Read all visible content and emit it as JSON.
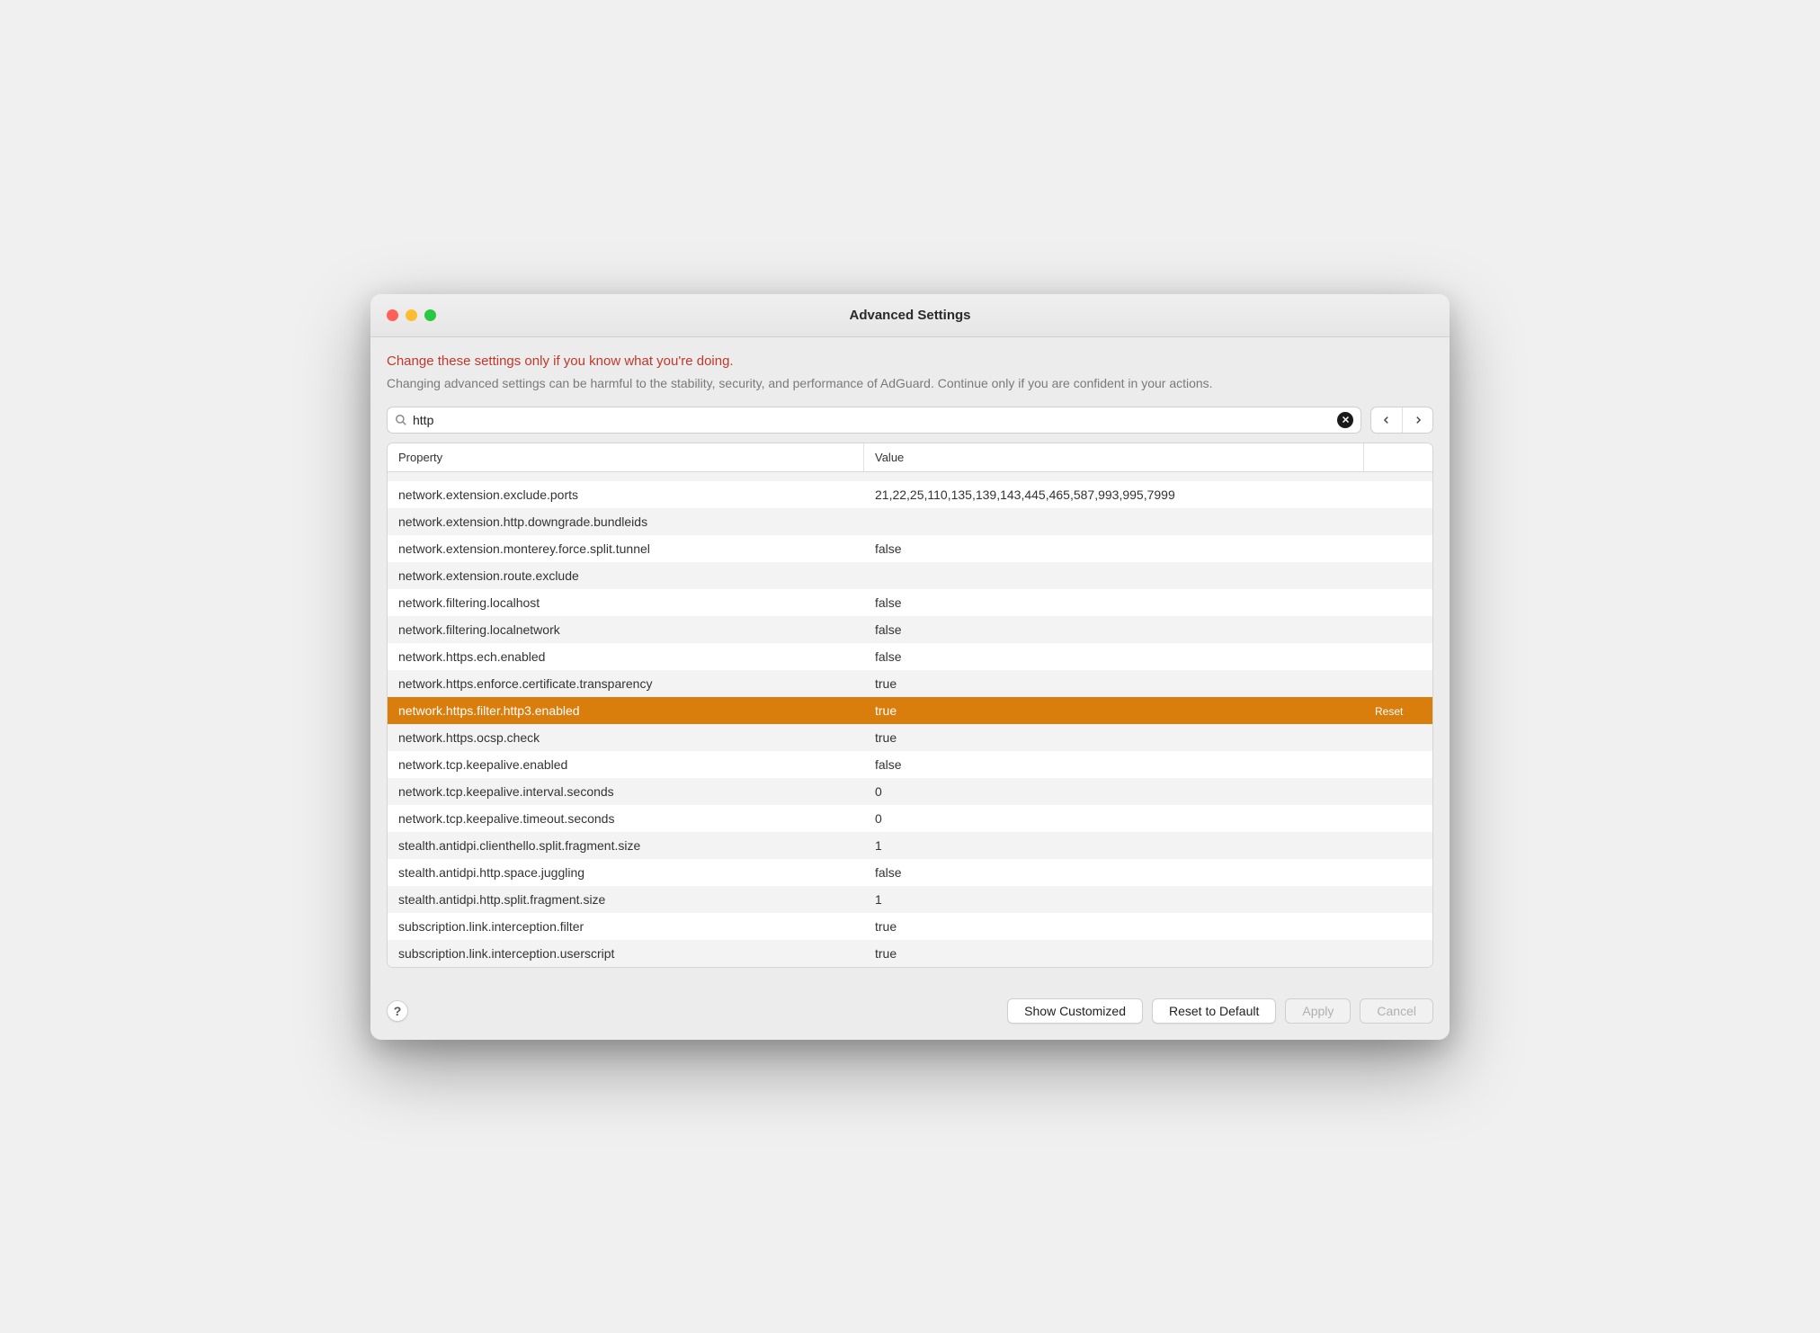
{
  "window": {
    "title": "Advanced Settings"
  },
  "warning": {
    "title": "Change these settings only if you know what you're doing.",
    "subtitle": "Changing advanced settings can be harmful to the stability, security, and performance of AdGuard. Continue only if you are confident in your actions."
  },
  "search": {
    "value": "http"
  },
  "table": {
    "headers": {
      "property": "Property",
      "value": "Value"
    },
    "rows": [
      {
        "property": "network.extension.exclude.ports",
        "value": "21,22,25,110,135,139,143,445,465,587,993,995,7999",
        "selected": false,
        "reset": ""
      },
      {
        "property": "network.extension.http.downgrade.bundleids",
        "value": "",
        "selected": false,
        "reset": ""
      },
      {
        "property": "network.extension.monterey.force.split.tunnel",
        "value": "false",
        "selected": false,
        "reset": ""
      },
      {
        "property": "network.extension.route.exclude",
        "value": "",
        "selected": false,
        "reset": ""
      },
      {
        "property": "network.filtering.localhost",
        "value": "false",
        "selected": false,
        "reset": ""
      },
      {
        "property": "network.filtering.localnetwork",
        "value": "false",
        "selected": false,
        "reset": ""
      },
      {
        "property": "network.https.ech.enabled",
        "value": "false",
        "selected": false,
        "reset": ""
      },
      {
        "property": "network.https.enforce.certificate.transparency",
        "value": "true",
        "selected": false,
        "reset": ""
      },
      {
        "property": "network.https.filter.http3.enabled",
        "value": "true",
        "selected": true,
        "reset": "Reset"
      },
      {
        "property": "network.https.ocsp.check",
        "value": "true",
        "selected": false,
        "reset": ""
      },
      {
        "property": "network.tcp.keepalive.enabled",
        "value": "false",
        "selected": false,
        "reset": ""
      },
      {
        "property": "network.tcp.keepalive.interval.seconds",
        "value": "0",
        "selected": false,
        "reset": ""
      },
      {
        "property": "network.tcp.keepalive.timeout.seconds",
        "value": "0",
        "selected": false,
        "reset": ""
      },
      {
        "property": "stealth.antidpi.clienthello.split.fragment.size",
        "value": "1",
        "selected": false,
        "reset": ""
      },
      {
        "property": "stealth.antidpi.http.space.juggling",
        "value": "false",
        "selected": false,
        "reset": ""
      },
      {
        "property": "stealth.antidpi.http.split.fragment.size",
        "value": "1",
        "selected": false,
        "reset": ""
      },
      {
        "property": "subscription.link.interception.filter",
        "value": "true",
        "selected": false,
        "reset": ""
      },
      {
        "property": "subscription.link.interception.userscript",
        "value": "true",
        "selected": false,
        "reset": ""
      }
    ]
  },
  "footer": {
    "help": "?",
    "show_customized": "Show Customized",
    "reset_to_default": "Reset to Default",
    "apply": "Apply",
    "cancel": "Cancel"
  }
}
